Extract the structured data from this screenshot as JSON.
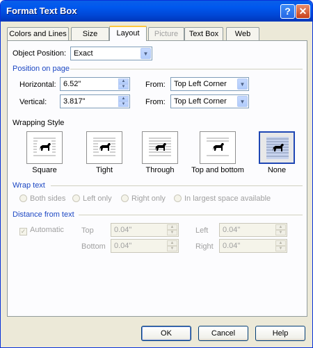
{
  "window": {
    "title": "Format Text Box",
    "help_glyph": "?",
    "close_glyph": "✕"
  },
  "tabs": [
    {
      "label": "Colors and Lines"
    },
    {
      "label": "Size"
    },
    {
      "label": "Layout",
      "active": true
    },
    {
      "label": "Picture",
      "disabled": true
    },
    {
      "label": "Text Box"
    },
    {
      "label": "Web"
    }
  ],
  "object_position": {
    "label": "Object Position:",
    "value": "Exact"
  },
  "position_on_page": {
    "heading": "Position on page",
    "horizontal": {
      "label": "Horizontal:",
      "value": "6.52\"",
      "from_label": "From:",
      "from_value": "Top Left Corner"
    },
    "vertical": {
      "label": "Vertical:",
      "value": "3.817\"",
      "from_label": "From:",
      "from_value": "Top Left Corner"
    }
  },
  "wrapping_style": {
    "heading": "Wrapping Style",
    "options": [
      {
        "label": "Square",
        "icon": "wrap-square-icon"
      },
      {
        "label": "Tight",
        "icon": "wrap-tight-icon"
      },
      {
        "label": "Through",
        "icon": "wrap-through-icon"
      },
      {
        "label": "Top and bottom",
        "icon": "wrap-top-bottom-icon"
      },
      {
        "label": "None",
        "icon": "wrap-none-icon",
        "selected": true
      }
    ]
  },
  "wrap_text": {
    "heading": "Wrap text",
    "options": [
      "Both sides",
      "Left only",
      "Right only",
      "In largest space available"
    ],
    "enabled": false
  },
  "distance_from_text": {
    "heading": "Distance from text",
    "automatic_label": "Automatic",
    "automatic_checked": true,
    "top": {
      "label": "Top",
      "value": "0.04\""
    },
    "bottom": {
      "label": "Bottom",
      "value": "0.04\""
    },
    "left": {
      "label": "Left",
      "value": "0.04\""
    },
    "right": {
      "label": "Right",
      "value": "0.04\""
    }
  },
  "buttons": {
    "ok": "OK",
    "cancel": "Cancel",
    "help": "Help"
  },
  "colors": {
    "title_bar": "#0058EE",
    "face": "#ECE9D8",
    "group_heading": "#1C47C3",
    "active_tab_accent": "#FFC83C"
  }
}
